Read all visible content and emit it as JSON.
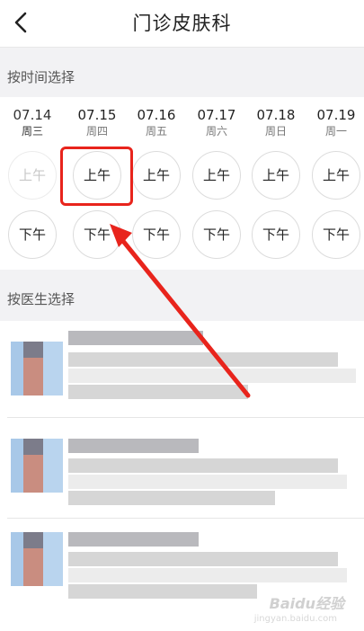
{
  "header": {
    "title": "门诊皮肤科",
    "back_icon": "chevron-left-icon"
  },
  "section_time": {
    "label": "按时间选择"
  },
  "dates": [
    {
      "date": "07.14",
      "weekday": "周三",
      "am": "上午",
      "pm": "下午",
      "am_available": false
    },
    {
      "date": "07.15",
      "weekday": "周四",
      "am": "上午",
      "pm": "下午",
      "am_available": true
    },
    {
      "date": "07.16",
      "weekday": "周五",
      "am": "上午",
      "pm": "下午",
      "am_available": true
    },
    {
      "date": "07.17",
      "weekday": "周六",
      "am": "上午",
      "pm": "下午",
      "am_available": true
    },
    {
      "date": "07.18",
      "weekday": "周日",
      "am": "上午",
      "pm": "下午",
      "am_available": true
    },
    {
      "date": "07.19",
      "weekday": "周一",
      "am": "上午",
      "pm": "下午",
      "am_available": true
    }
  ],
  "section_doctor": {
    "label": "按医生选择"
  },
  "watermark": {
    "logo": "Baidu经验",
    "sub": "jingyan.baidu.com"
  },
  "colors": {
    "highlight": "#e8241c",
    "section_bg": "#f2f2f4"
  }
}
